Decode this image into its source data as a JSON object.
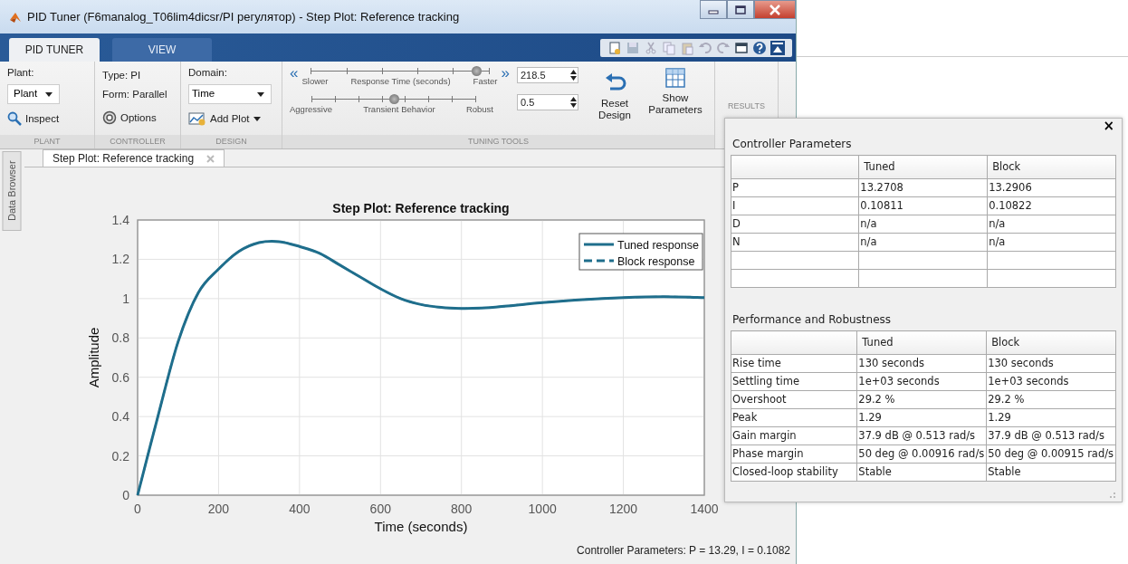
{
  "window": {
    "title": "PID Tuner (F6manalog_T06lim4dicsr/PI регулятор) - Step Plot: Reference tracking"
  },
  "ribbon_tabs": [
    {
      "label": "PID TUNER",
      "selected": true
    },
    {
      "label": "VIEW",
      "selected": false
    }
  ],
  "plant": {
    "label": "Plant:",
    "dropdown": "Plant",
    "inspect": "Inspect",
    "section": "PLANT"
  },
  "controller": {
    "type": "Type: PI",
    "form": "Form: Parallel",
    "options": "Options",
    "section": "CONTROLLER"
  },
  "design": {
    "domain_label": "Domain:",
    "domain": "Time",
    "add_plot": "Add Plot",
    "section": "DESIGN"
  },
  "tuning": {
    "section": "TUNING TOOLS",
    "left_arrow": "«",
    "right_arrow": "»",
    "response": {
      "left": "Slower",
      "label": "Response Time (seconds)",
      "right": "Faster",
      "level": 0.93,
      "value": "218.5"
    },
    "transient": {
      "left": "Aggressive",
      "label": "Transient Behavior",
      "right": "Robust",
      "level": 0.5,
      "value": "0.5"
    },
    "reset": "Reset Design",
    "show": "Show Parameters"
  },
  "results": {
    "section": "RESULTS"
  },
  "side_tab": "Data Browser",
  "doc_tabs": [
    {
      "label": "Step Plot: Reference tracking",
      "selected": true
    }
  ],
  "plot": {
    "chart_data": {
      "type": "line",
      "title": "Step Plot: Reference tracking",
      "xlabel": "Time (seconds)",
      "ylabel": "Amplitude",
      "x": [
        0,
        50,
        100,
        150,
        200,
        250,
        300,
        350,
        400,
        450,
        500,
        550,
        600,
        650,
        700,
        750,
        800,
        850,
        900,
        950,
        1000,
        1100,
        1200,
        1300,
        1400
      ],
      "series": [
        {
          "name": "Tuned response",
          "color": "#1f6e8c",
          "line_style": "solid",
          "values": [
            0,
            0.4,
            0.78,
            1.03,
            1.15,
            1.24,
            1.285,
            1.29,
            1.265,
            1.23,
            1.17,
            1.11,
            1.05,
            1.0,
            0.97,
            0.955,
            0.95,
            0.952,
            0.96,
            0.97,
            0.98,
            0.995,
            1.005,
            1.01,
            1.005
          ]
        },
        {
          "name": "Block response",
          "color": "#1f6e8c",
          "line_style": "dashed",
          "values": [
            0,
            0.4,
            0.78,
            1.03,
            1.15,
            1.24,
            1.285,
            1.29,
            1.265,
            1.23,
            1.17,
            1.11,
            1.05,
            1.0,
            0.97,
            0.955,
            0.95,
            0.952,
            0.96,
            0.97,
            0.98,
            0.995,
            1.005,
            1.01,
            1.005
          ]
        }
      ],
      "grid": true,
      "legend": true,
      "xlim": [
        0,
        1400
      ],
      "ylim": [
        0,
        1.4
      ],
      "xticks": [
        0,
        200,
        400,
        600,
        800,
        1000,
        1200,
        1400
      ],
      "yticks": [
        0,
        0.2,
        0.4,
        0.6,
        0.8,
        1,
        1.2,
        1.4
      ]
    }
  },
  "status": "Controller Parameters: P = 13.29, I = 0.1082",
  "panel": {
    "close": "×",
    "controller_parameters": {
      "title": "Controller Parameters",
      "columns": [
        "",
        "Tuned",
        "Block"
      ],
      "rows": [
        [
          "P",
          "13.2708",
          "13.2906"
        ],
        [
          "I",
          "0.10811",
          "0.10822"
        ],
        [
          "D",
          "n/a",
          "n/a"
        ],
        [
          "N",
          "n/a",
          "n/a"
        ]
      ]
    },
    "performance": {
      "title": "Performance and Robustness",
      "columns": [
        "",
        "Tuned",
        "Block"
      ],
      "rows": [
        [
          "Rise time",
          "130 seconds",
          "130 seconds"
        ],
        [
          "Settling time",
          "1e+03 seconds",
          "1e+03 seconds"
        ],
        [
          "Overshoot",
          "29.2 %",
          "29.2 %"
        ],
        [
          "Peak",
          "1.29",
          "1.29"
        ],
        [
          "Gain margin",
          "37.9 dB @ 0.513 rad/s",
          "37.9 dB @ 0.513 rad/s"
        ],
        [
          "Phase margin",
          "50 deg @ 0.00916 rad/s",
          "50 deg @ 0.00915 rad/s"
        ],
        [
          "Closed-loop stability",
          "Stable",
          "Stable"
        ]
      ]
    }
  }
}
